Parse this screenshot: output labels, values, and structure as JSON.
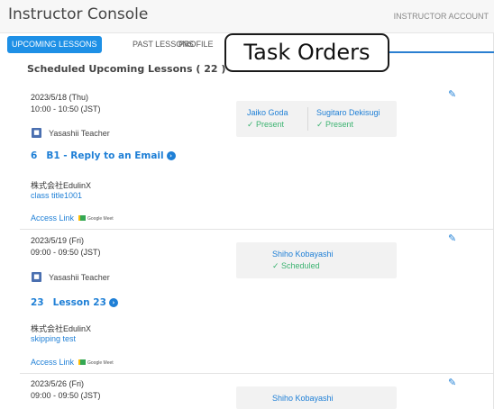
{
  "header": {
    "title": "Instructor Console",
    "account": "INSTRUCTOR ACCOUNT"
  },
  "tabs": [
    {
      "label": "UPCOMING LESSONS",
      "active": true
    },
    {
      "label": "PAST LESSONS",
      "active": false
    },
    {
      "label": "PROFILE",
      "active": false
    }
  ],
  "section_title": "Scheduled Upcoming Lessons ( 22 )",
  "callout": "Task Orders",
  "lessons": [
    {
      "date": "2023/5/18 (Thu)",
      "time": "10:00 - 10:50 (JST)",
      "teacher": "Yasashii Teacher",
      "course_number": "6",
      "course_title": "B1 - Reply to an Email",
      "company": "株式会社EdulinX",
      "class_title": "class title1001",
      "access_link": "Access Link",
      "meet_label": "Google Meet",
      "students": [
        {
          "name": "Jaiko Goda",
          "status": "✓ Present"
        },
        {
          "name": "Sugitaro Dekisugi",
          "status": "✓ Present"
        }
      ]
    },
    {
      "date": "2023/5/19 (Fri)",
      "time": "09:00 - 09:50 (JST)",
      "teacher": "Yasashii Teacher",
      "course_number": "23",
      "course_title": "Lesson 23",
      "company": "株式会社EdulinX",
      "class_title": "skipping test",
      "access_link": "Access Link",
      "meet_label": "Google Meet",
      "students": [
        {
          "name": "Shiho Kobayashi",
          "status": "✓ Scheduled"
        }
      ]
    },
    {
      "date": "2023/5/26 (Fri)",
      "time": "09:00 - 09:50 (JST)",
      "students": [
        {
          "name": "Shiho Kobayashi"
        }
      ]
    }
  ],
  "icons": {
    "edit": "edit-icon",
    "teacher": "teacher-icon",
    "arrow": "arrow-circle-right-icon",
    "meet": "google-meet-icon"
  },
  "colors": {
    "accent": "#1e90e6",
    "link": "#1e7fd6",
    "status_green": "#3cb371",
    "callout_line": "#2a7fd1"
  }
}
